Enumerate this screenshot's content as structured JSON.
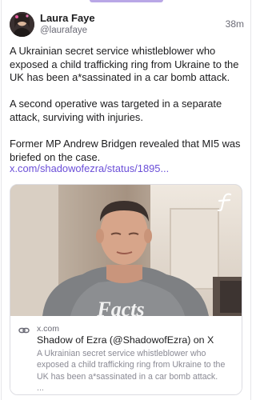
{
  "post": {
    "author_name": "Laura Faye",
    "author_handle": "@laurafaye",
    "time_ago": "38m",
    "paragraphs": [
      "A Ukrainian secret service whistleblower who exposed a child trafficking ring from Ukraine to the UK has been a*sassinated in a car bomb attack.",
      "A second operative was targeted in a separate attack, surviving with injuries.",
      "Former MP Andrew Bridgen revealed that MI5 was briefed on the case."
    ],
    "link_text": "x.com/shadowofezra/status/1895..."
  },
  "card": {
    "image_shirt_text": "Facts",
    "domain": "x.com",
    "title": "Shadow of Ezra (@ShadowofEzra) on X",
    "description": "A Ukrainian secret service whistleblower who exposed a child trafficking ring from Ukraine to the UK has been a*sassinated in a car bomb attack.",
    "ellipsis": "..."
  },
  "colors": {
    "link": "#6b4fd8",
    "muted": "#6b6b76",
    "accent_strip": "#b9a7e6"
  },
  "icons": {
    "avatar": "avatar-icon",
    "brand": "brand-f-icon",
    "link": "link-chain-icon"
  }
}
